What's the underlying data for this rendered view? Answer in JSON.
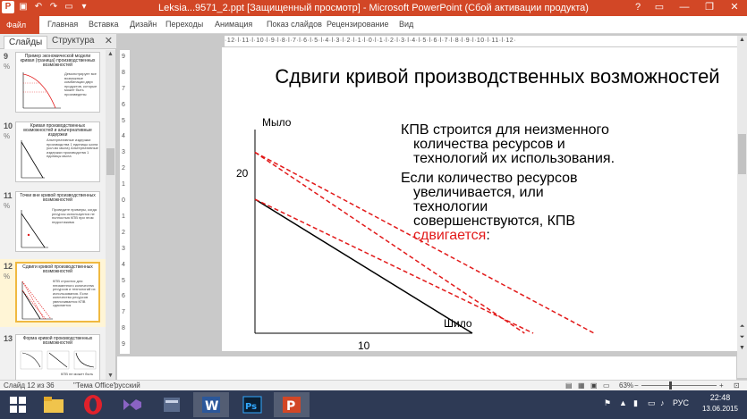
{
  "window": {
    "title": "Leksia...9571_2.ppt [Защищенный просмотр] - Microsoft PowerPoint (Сбой активации продукта)",
    "help": "?",
    "minimize": "—",
    "restore": "❐",
    "close": "✕"
  },
  "ribbon": {
    "tabs": [
      "Файл",
      "Главная",
      "Вставка",
      "Дизайн",
      "Переходы",
      "Анимация",
      "Показ слайдов",
      "Рецензирование",
      "Вид"
    ]
  },
  "left_pane": {
    "tabs": [
      "Слайды",
      "Структура"
    ],
    "close": "✕",
    "thumbnails": [
      {
        "num": "9",
        "anim": "%",
        "title": "Пример экономической модели кривая (граница) производственных возможностей",
        "text": "Демонстрирует все возможные комбинации двух продуктов, которые может быть произведены"
      },
      {
        "num": "10",
        "anim": "%",
        "title": "Кривая производственных возможностей и альтернативные издержки",
        "text": "Альтернативные издержки производства 1 единицы шила (кол-во мыла) Альтернативные издержки производства 1 единицы мыла"
      },
      {
        "num": "11",
        "anim": "%",
        "title": "Точки вне кривой производственных возможностей",
        "text": "Проведите примеры, когда ресурсы используются не полностью КПВ при этом недостижима"
      },
      {
        "num": "12",
        "anim": "%",
        "title": "Сдвиги кривой производственных возможностей",
        "text": "КПВ строится для неизменного количества ресурсов и технологий их использования. Если количество ресурсов увеличивается КПВ сдвигается"
      },
      {
        "num": "13",
        "anim": "",
        "title": "Форма кривой производственных возможностей",
        "text": "КПВ не может быть"
      }
    ]
  },
  "ruler": {
    "horizontal": "·12·l·11·l·10·l·9·l·8·l·7·l·6·l·5·l·4·l·3·l·2·l·1·l·0·l·1·l·2·l·3·l·4·l·5·l·6·l·7·l·8·l·9·l·10·l·11·l·12·",
    "vertical": [
      "9",
      "8",
      "7",
      "6",
      "5",
      "4",
      "3",
      "2",
      "1",
      "0",
      "1",
      "2",
      "3",
      "4",
      "5",
      "6",
      "7",
      "8",
      "9"
    ]
  },
  "slide": {
    "title": "Сдвиги кривой производственных возможностей",
    "para1": "КПВ строится для неизменного количества ресурсов и технологий их использования.",
    "para2_main": "Если количество ресурсов увеличивается, или технологии совершенствуются, КПВ ",
    "para2_red": "сдвигается",
    "para2_end": ":"
  },
  "chart_data": {
    "type": "line",
    "ylabel": "Мыло",
    "xlabel": "Шило",
    "y_tick": "20",
    "x_tick": "10",
    "series": [
      {
        "style": "solid",
        "color": "#000000",
        "points": [
          [
            0,
            20
          ],
          [
            10,
            0
          ]
        ]
      },
      {
        "style": "dashed",
        "color": "#e21a1a",
        "points": [
          [
            0,
            20
          ],
          [
            12.8,
            0
          ]
        ]
      },
      {
        "style": "dashed",
        "color": "#e21a1a",
        "points": [
          [
            0,
            27
          ],
          [
            12.4,
            0
          ]
        ]
      },
      {
        "style": "dashed",
        "color": "#e21a1a",
        "points": [
          [
            0,
            27
          ],
          [
            15.6,
            0
          ]
        ]
      }
    ]
  },
  "status": {
    "slide": "Слайд 12 из 36",
    "theme": "\"Тема Office\"",
    "lang": "русский",
    "zoom": "63%",
    "zoom_minus": "−",
    "zoom_plus": "+"
  },
  "taskbar": {
    "lang": "РУС",
    "time": "22:48",
    "date": "13.06.2015"
  },
  "colors": {
    "accent": "#d24726",
    "taskbar": "#2e3a55",
    "red": "#e21a1a"
  }
}
